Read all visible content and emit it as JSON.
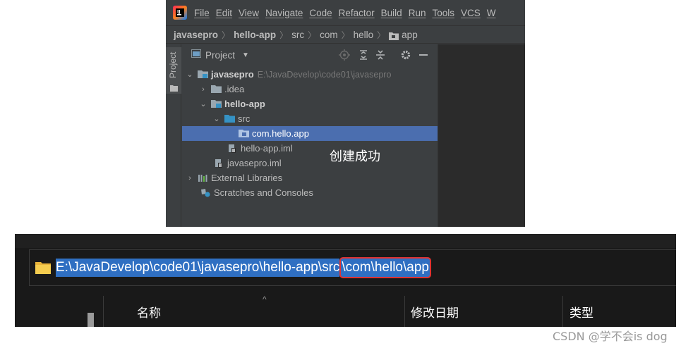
{
  "ide": {
    "menu": [
      "File",
      "Edit",
      "View",
      "Navigate",
      "Code",
      "Refactor",
      "Build",
      "Run",
      "Tools",
      "VCS",
      "W"
    ],
    "breadcrumb": [
      "javasepro",
      "hello-app",
      "src",
      "com",
      "hello",
      "app"
    ],
    "tool_window_tab": "Project",
    "panel_title": "Project",
    "tree": [
      {
        "label": "javasepro",
        "path": "E:\\JavaDevelop\\code01\\javasepro",
        "expanded": true
      },
      {
        "label": ".idea",
        "expanded": false
      },
      {
        "label": "hello-app",
        "expanded": true
      },
      {
        "label": "src",
        "expanded": true
      },
      {
        "label": "com.hello.app",
        "selected": true
      },
      {
        "label": "hello-app.iml"
      },
      {
        "label": "javasepro.iml"
      },
      {
        "label": "External Libraries",
        "expanded": false
      },
      {
        "label": "Scratches and Consoles"
      }
    ],
    "annotation": "创建成功",
    "colors": {
      "background": "#3c3f41",
      "selection": "#4b6eaf",
      "editor": "#2b2b2b"
    }
  },
  "explorer": {
    "address_part1": "E:\\JavaDevelop\\code01\\javasepro\\hello-app\\src",
    "address_part2": "\\com\\hello\\app",
    "columns": [
      "名称",
      "修改日期",
      "类型"
    ],
    "colors": {
      "highlight": "#2f6fc2",
      "circle": "#e03232",
      "folder": "#f0c44c"
    }
  },
  "watermark": "CSDN @学不会is dog"
}
